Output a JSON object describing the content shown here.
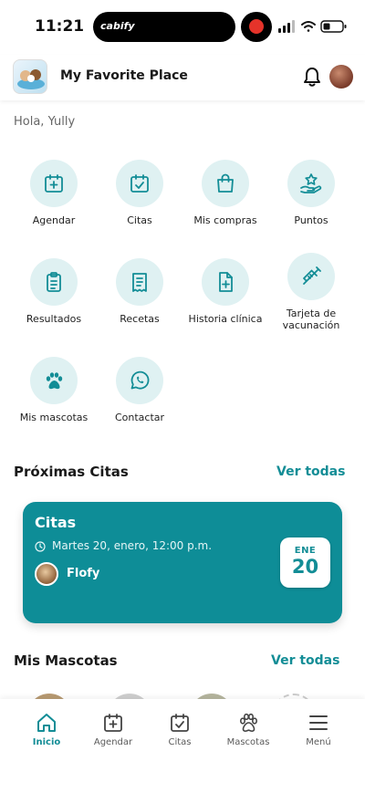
{
  "status_bar": {
    "time": "11:21",
    "live_activity": "cabify"
  },
  "header": {
    "title": "My Favorite Place",
    "icons": [
      "bell-icon",
      "avatar"
    ]
  },
  "greeting": "Hola, Yully",
  "actions": [
    {
      "label": "Agendar",
      "icon": "calendar-plus-icon"
    },
    {
      "label": "Citas",
      "icon": "calendar-check-icon"
    },
    {
      "label": "Mis compras",
      "icon": "shopping-bag-icon"
    },
    {
      "label": "Puntos",
      "icon": "hand-star-icon"
    },
    {
      "label": "Resultados",
      "icon": "clipboard-icon"
    },
    {
      "label": "Recetas",
      "icon": "receipt-icon"
    },
    {
      "label": "Historia clínica",
      "icon": "file-plus-icon"
    },
    {
      "label": "Tarjeta de vacunación",
      "icon": "syringe-icon"
    },
    {
      "label": "Mis mascotas",
      "icon": "paw-icon"
    },
    {
      "label": "Contactar",
      "icon": "whatsapp-icon"
    }
  ],
  "upcoming": {
    "title": "Próximas Citas",
    "see_all": "Ver todas",
    "card": {
      "title": "Citas",
      "datetime": "Martes 20, enero, 12:00 p.m.",
      "pet": "Flofy",
      "month": "ENE",
      "day": "20"
    }
  },
  "pets": {
    "title": "Mis Mascotas",
    "see_all": "Ver todas"
  },
  "nav": [
    {
      "label": "Inicio",
      "icon": "home-icon",
      "active": true
    },
    {
      "label": "Agendar",
      "icon": "calendar-plus-icon",
      "active": false
    },
    {
      "label": "Citas",
      "icon": "calendar-check-icon",
      "active": false
    },
    {
      "label": "Mascotas",
      "icon": "paw-icon",
      "active": false
    },
    {
      "label": "Menú",
      "icon": "menu-icon",
      "active": false
    }
  ],
  "colors": {
    "accent": "#138d96",
    "card": "#0e8d97",
    "icon_bg": "#dff1f2"
  }
}
